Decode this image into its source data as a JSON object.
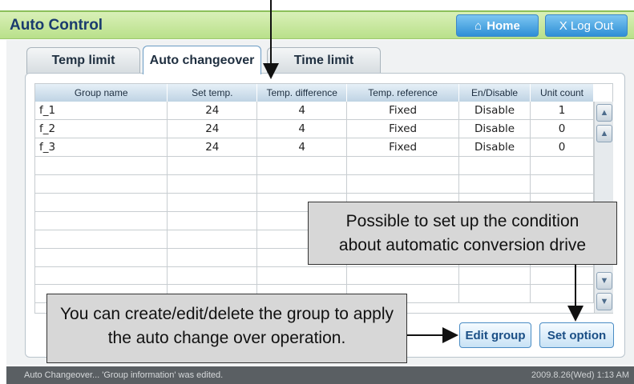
{
  "header": {
    "title": "Auto Control",
    "home_label": "Home",
    "logout_label": "X Log Out"
  },
  "tabs": [
    {
      "label": "Temp limit"
    },
    {
      "label": "Auto changeover"
    },
    {
      "label": "Time limit"
    }
  ],
  "table": {
    "columns": [
      "Group name",
      "Set temp.",
      "Temp. difference",
      "Temp. reference",
      "En/Disable",
      "Unit count"
    ],
    "rows": [
      [
        "f_1",
        "24",
        "4",
        "Fixed",
        "Disable",
        "1"
      ],
      [
        "f_2",
        "24",
        "4",
        "Fixed",
        "Disable",
        "0"
      ],
      [
        "f_3",
        "24",
        "4",
        "Fixed",
        "Disable",
        "0"
      ],
      [
        "",
        "",
        "",
        "",
        "",
        ""
      ],
      [
        "",
        "",
        "",
        "",
        "",
        ""
      ],
      [
        "",
        "",
        "",
        "",
        "",
        ""
      ],
      [
        "",
        "",
        "",
        "",
        "",
        ""
      ],
      [
        "",
        "",
        "",
        "",
        "",
        ""
      ],
      [
        "",
        "",
        "",
        "",
        "",
        ""
      ],
      [
        "",
        "",
        "",
        "",
        "",
        ""
      ],
      [
        "",
        "",
        "",
        "",
        "",
        ""
      ]
    ]
  },
  "callouts": {
    "top_line1": "Possible to set up the condition",
    "top_line2": "about automatic conversion drive",
    "bottom_line1": "You can create/edit/delete the group to apply",
    "bottom_line2": "the auto change over operation."
  },
  "buttons": {
    "edit_group": "Edit group",
    "set_option": "Set option"
  },
  "status": {
    "message": "Auto Changeover... 'Group information' was edited.",
    "datetime": "2009.8.26(Wed)  1:13 AM"
  },
  "icons": {
    "home": "home-icon",
    "scroll_top": "double-chevron-up-icon",
    "scroll_up": "chevron-up-icon",
    "scroll_down": "chevron-down-icon",
    "scroll_bottom": "double-chevron-down-icon"
  }
}
